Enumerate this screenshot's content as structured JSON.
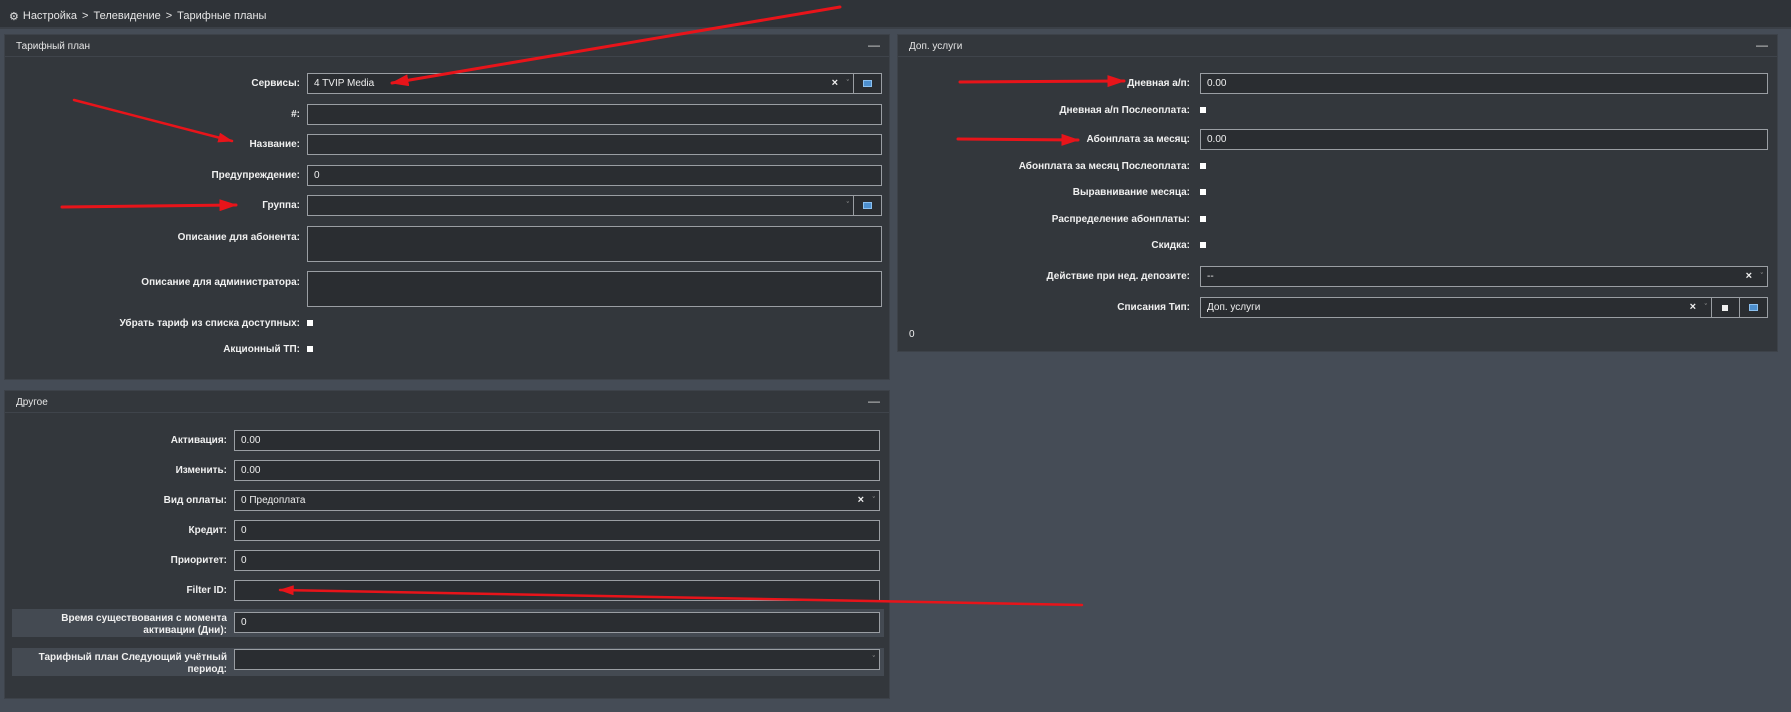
{
  "breadcrumb": {
    "items": [
      "Настройка",
      "Телевидение",
      "Тарифные планы"
    ],
    "separator": ">",
    "icon": "gear-icon"
  },
  "tariff_panel": {
    "title": "Тарифный план",
    "collapse_symbol": "—",
    "services": {
      "label": "Сервисы:",
      "value": "4 TVIP Media"
    },
    "number": {
      "label": "#:",
      "value": ""
    },
    "name": {
      "label": "Название:",
      "value": ""
    },
    "warning": {
      "label": "Предупреждение:",
      "value": "0"
    },
    "group": {
      "label": "Группа:",
      "value": ""
    },
    "subscriber_desc": {
      "label": "Описание для абонента:",
      "value": ""
    },
    "admin_desc": {
      "label": "Описание для администратора:",
      "value": ""
    },
    "remove_from_list": {
      "label": "Убрать тариф из списка доступных:",
      "checked": false
    },
    "promo": {
      "label": "Акционный ТП:",
      "checked": false
    }
  },
  "other_panel": {
    "title": "Другое",
    "collapse_symbol": "—",
    "activation": {
      "label": "Активация:",
      "value": "0.00"
    },
    "change": {
      "label": "Изменить:",
      "value": "0.00"
    },
    "payment_type": {
      "label": "Вид оплаты:",
      "value": "0 Предоплата"
    },
    "credit": {
      "label": "Кредит:",
      "value": "0"
    },
    "priority": {
      "label": "Приоритет:",
      "value": "0"
    },
    "filter_id": {
      "label": "Filter ID:",
      "value": ""
    },
    "lifetime": {
      "label": "Время существования с момента активации (Дни):",
      "value": "0"
    },
    "next_tariff": {
      "label": "Тарифный план Следующий учётный период:",
      "value": ""
    }
  },
  "extra_panel": {
    "title": "Доп. услуги",
    "collapse_symbol": "—",
    "daily_fee": {
      "label": "Дневная а/п:",
      "value": "0.00"
    },
    "daily_postpaid": {
      "label": "Дневная а/п Послеоплата:",
      "checked": false
    },
    "monthly_fee": {
      "label": "Абонплата за месяц:",
      "value": "0.00"
    },
    "monthly_postpaid": {
      "label": "Абонплата за месяц Послеоплата:",
      "checked": false
    },
    "month_align": {
      "label": "Выравнивание месяца:",
      "checked": false
    },
    "fee_distribution": {
      "label": "Распределение абонплаты:",
      "checked": false
    },
    "discount": {
      "label": "Скидка:",
      "checked": false
    },
    "low_deposit_action": {
      "label": "Действие при нед. депозите:",
      "value": "--"
    },
    "writeoff_type": {
      "label": "Списания Тип:",
      "value": "Доп. услуги"
    },
    "footer_value": "0"
  },
  "symbols": {
    "clear": "×",
    "caret": "ˇ"
  },
  "colors": {
    "background": "#454c56",
    "panel": "#33373c",
    "input_bg": "#2a2d31",
    "input_border": "#9a9ea3",
    "grid_icon": "#4d8fce",
    "arrow": "#e8141a"
  }
}
